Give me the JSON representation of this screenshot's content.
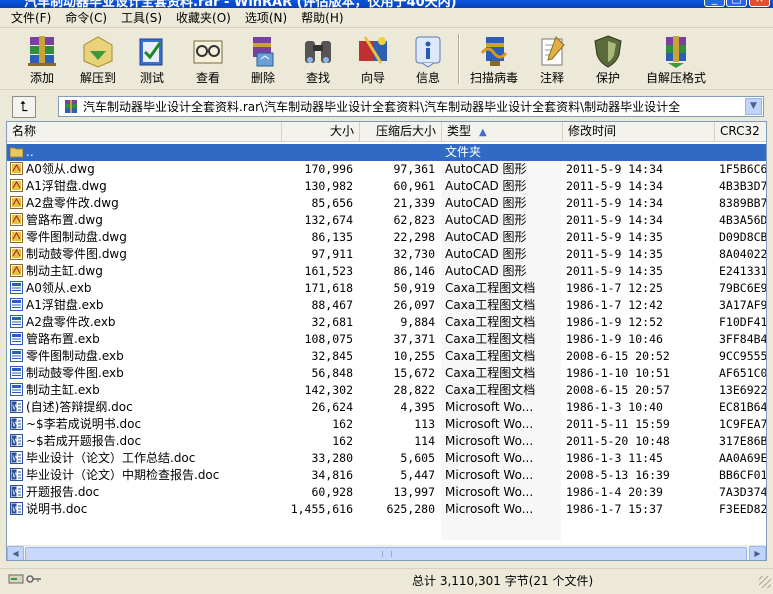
{
  "window": {
    "title": "汽车制动器毕业设计全套资料.rar - WinRAR (评估版本，仅用于40天内)",
    "min_glyph": "_",
    "max_glyph": "□",
    "close_glyph": "×"
  },
  "menu": [
    "文件(F)",
    "命令(C)",
    "工具(S)",
    "收藏夹(O)",
    "选项(N)",
    "帮助(H)"
  ],
  "toolbar": [
    {
      "label": "添加",
      "icon": "add-archive-icon"
    },
    {
      "label": "解压到",
      "icon": "extract-to-icon"
    },
    {
      "label": "测试",
      "icon": "test-icon"
    },
    {
      "label": "查看",
      "icon": "view-icon"
    },
    {
      "label": "删除",
      "icon": "delete-icon"
    },
    {
      "label": "查找",
      "icon": "find-icon"
    },
    {
      "label": "向导",
      "icon": "wizard-icon"
    },
    {
      "label": "信息",
      "icon": "info-icon"
    },
    {
      "label": "扫描病毒",
      "icon": "virus-scan-icon"
    },
    {
      "label": "注释",
      "icon": "comment-icon"
    },
    {
      "label": "保护",
      "icon": "protect-icon"
    },
    {
      "label": "自解压格式",
      "icon": "sfx-icon"
    }
  ],
  "address": {
    "path": "汽车制动器毕业设计全套资料.rar\\汽车制动器毕业设计全套资料\\汽车制动器毕业设计全套资料\\制动器毕业设计全",
    "up_glyph": "⮤"
  },
  "columns": {
    "name": "名称",
    "size": "大小",
    "packed": "压缩后大小",
    "type": "类型",
    "type_sort_glyph": "▲",
    "modified": "修改时间",
    "crc": "CRC32"
  },
  "rows": [
    {
      "name": "..",
      "size": "",
      "packed": "",
      "type": "文件夹",
      "date": "",
      "crc": "",
      "kind": "folder",
      "selected": true
    },
    {
      "name": "A0领从.dwg",
      "size": "170,996",
      "packed": "97,361",
      "type": "AutoCAD 图形",
      "date": "2011-5-9 14:34",
      "crc": "1F5B6C6",
      "kind": "dwg"
    },
    {
      "name": "A1浮钳盘.dwg",
      "size": "130,982",
      "packed": "60,961",
      "type": "AutoCAD 图形",
      "date": "2011-5-9 14:34",
      "crc": "4B3B3D7",
      "kind": "dwg"
    },
    {
      "name": "A2盘零件改.dwg",
      "size": "85,656",
      "packed": "21,339",
      "type": "AutoCAD 图形",
      "date": "2011-5-9 14:34",
      "crc": "8389BB7",
      "kind": "dwg"
    },
    {
      "name": "管路布置.dwg",
      "size": "132,674",
      "packed": "62,823",
      "type": "AutoCAD 图形",
      "date": "2011-5-9 14:34",
      "crc": "4B3A56D",
      "kind": "dwg"
    },
    {
      "name": "零件图制动盘.dwg",
      "size": "86,135",
      "packed": "22,298",
      "type": "AutoCAD 图形",
      "date": "2011-5-9 14:35",
      "crc": "D09D8CB",
      "kind": "dwg"
    },
    {
      "name": "制动鼓零件图.dwg",
      "size": "97,911",
      "packed": "32,730",
      "type": "AutoCAD 图形",
      "date": "2011-5-9 14:35",
      "crc": "8A04022",
      "kind": "dwg"
    },
    {
      "name": "制动主缸.dwg",
      "size": "161,523",
      "packed": "86,146",
      "type": "AutoCAD 图形",
      "date": "2011-5-9 14:35",
      "crc": "E241331",
      "kind": "dwg"
    },
    {
      "name": "A0领从.exb",
      "size": "171,618",
      "packed": "50,919",
      "type": "Caxa工程图文档",
      "date": "1986-1-7 12:25",
      "crc": "79BC6E9",
      "kind": "exb"
    },
    {
      "name": "A1浮钳盘.exb",
      "size": "88,467",
      "packed": "26,097",
      "type": "Caxa工程图文档",
      "date": "1986-1-7 12:42",
      "crc": "3A17AF9",
      "kind": "exb"
    },
    {
      "name": "A2盘零件改.exb",
      "size": "32,681",
      "packed": "9,884",
      "type": "Caxa工程图文档",
      "date": "1986-1-9 12:52",
      "crc": "F10DF41",
      "kind": "exb"
    },
    {
      "name": "管路布置.exb",
      "size": "108,075",
      "packed": "37,371",
      "type": "Caxa工程图文档",
      "date": "1986-1-9 10:46",
      "crc": "3FF84B4",
      "kind": "exb"
    },
    {
      "name": "零件图制动盘.exb",
      "size": "32,845",
      "packed": "10,255",
      "type": "Caxa工程图文档",
      "date": "2008-6-15 20:52",
      "crc": "9CC9555",
      "kind": "exb"
    },
    {
      "name": "制动鼓零件图.exb",
      "size": "56,848",
      "packed": "15,672",
      "type": "Caxa工程图文档",
      "date": "1986-1-10 10:51",
      "crc": "AF651C0",
      "kind": "exb"
    },
    {
      "name": "制动主缸.exb",
      "size": "142,302",
      "packed": "28,822",
      "type": "Caxa工程图文档",
      "date": "2008-6-15 20:57",
      "crc": "13E6922",
      "kind": "exb"
    },
    {
      "name": "(自述)答辩提纲.doc",
      "size": "26,624",
      "packed": "4,395",
      "type": "Microsoft Wo...",
      "date": "1986-1-3 10:40",
      "crc": "EC81B64",
      "kind": "doc"
    },
    {
      "name": "~$李若成说明书.doc",
      "size": "162",
      "packed": "113",
      "type": "Microsoft Wo...",
      "date": "2011-5-11 15:59",
      "crc": "1C9FEA7",
      "kind": "doc"
    },
    {
      "name": "~$若成开题报告.doc",
      "size": "162",
      "packed": "114",
      "type": "Microsoft Wo...",
      "date": "2011-5-20 10:48",
      "crc": "317E86B",
      "kind": "doc"
    },
    {
      "name": "毕业设计（论文）工作总结.doc",
      "size": "33,280",
      "packed": "5,605",
      "type": "Microsoft Wo...",
      "date": "1986-1-3 11:45",
      "crc": "AA0A69E",
      "kind": "doc"
    },
    {
      "name": "毕业设计（论文）中期检查报告.doc",
      "size": "34,816",
      "packed": "5,447",
      "type": "Microsoft Wo...",
      "date": "2008-5-13 16:39",
      "crc": "BB6CF01",
      "kind": "doc"
    },
    {
      "name": "开题报告.doc",
      "size": "60,928",
      "packed": "13,997",
      "type": "Microsoft Wo...",
      "date": "1986-1-4 20:39",
      "crc": "7A3D374",
      "kind": "doc"
    },
    {
      "name": "说明书.doc",
      "size": "1,455,616",
      "packed": "625,280",
      "type": "Microsoft Wo...",
      "date": "1986-1-7 15:37",
      "crc": "F3EED82",
      "kind": "doc"
    }
  ],
  "status": {
    "text": "总计 3,110,301 字节(21 个文件)"
  },
  "colors": {
    "selection": "#316ac5",
    "titlebar": "#0a58e0",
    "window_bg": "#ece9d8"
  }
}
